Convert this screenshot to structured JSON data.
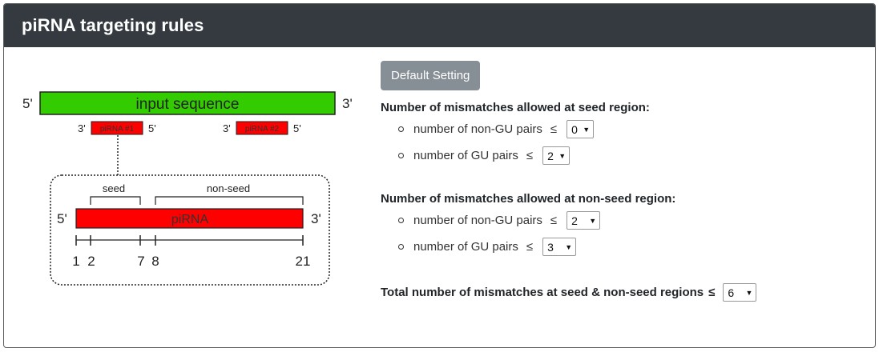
{
  "header": {
    "title": "piRNA targeting rules"
  },
  "figure": {
    "input_sequence": "input sequence",
    "five_prime": "5'",
    "three_prime": "3'",
    "pirna1": "piRNA #1",
    "pirna2": "piRNA #2",
    "seed": "seed",
    "non_seed": "non-seed",
    "pirna": "piRNA",
    "positions": [
      "1",
      "2",
      "7",
      "8",
      "21"
    ]
  },
  "settings": {
    "default_button": "Default Setting",
    "seed_section": {
      "title": "Number of mismatches allowed at seed region:",
      "non_gu_label": "number of non-GU pairs",
      "non_gu_value": "0",
      "gu_label": "number of GU pairs",
      "gu_value": "2"
    },
    "nonseed_section": {
      "title": "Number of mismatches allowed at non-seed region:",
      "non_gu_label": "number of non-GU pairs",
      "non_gu_value": "2",
      "gu_label": "number of GU pairs",
      "gu_value": "3"
    },
    "total": {
      "label": "Total number of mismatches at seed & non-seed regions",
      "value": "6"
    },
    "leq_symbol": "≤",
    "caret": "▼"
  },
  "colors": {
    "header_bg": "#343a40",
    "button_bg": "#868e96",
    "input_sequence_green": "#33cc00",
    "pirna_red": "#ff0000"
  }
}
